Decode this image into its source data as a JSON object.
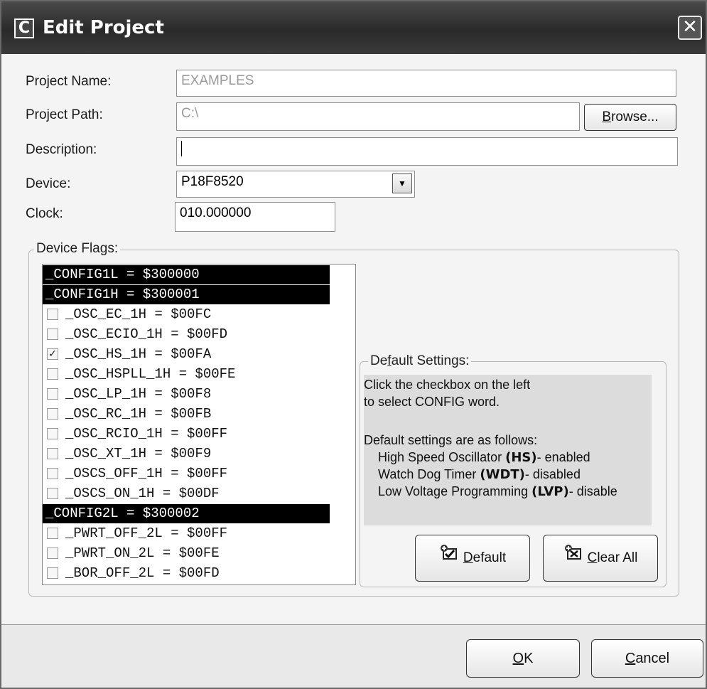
{
  "window": {
    "title": "Edit Project",
    "app_icon": "C",
    "close_icon": "close-icon"
  },
  "form": {
    "project_name_label": "Project Name:",
    "project_name_value": "EXAMPLES",
    "project_path_label": "Project Path:",
    "project_path_value": "C:\\",
    "browse_pre": "",
    "browse_key": "B",
    "browse_post": "rowse...",
    "description_label": "Description:",
    "description_value": "",
    "device_label": "Device:",
    "device_value": "P18F8520",
    "clock_label": "Clock:",
    "clock_value": "010.000000"
  },
  "device_flags": {
    "group_label": "Device Flags:",
    "rows": [
      {
        "type": "header",
        "text": "_CONFIG1L = $300000"
      },
      {
        "type": "header",
        "text": "_CONFIG1H = $300001"
      },
      {
        "type": "item",
        "checked": false,
        "text": "_OSC_EC_1H = $00FC"
      },
      {
        "type": "item",
        "checked": false,
        "text": "_OSC_ECIO_1H = $00FD"
      },
      {
        "type": "item",
        "checked": true,
        "text": "_OSC_HS_1H = $00FA"
      },
      {
        "type": "item",
        "checked": false,
        "text": "_OSC_HSPLL_1H = $00FE"
      },
      {
        "type": "item",
        "checked": false,
        "text": "_OSC_LP_1H = $00F8"
      },
      {
        "type": "item",
        "checked": false,
        "text": "_OSC_RC_1H = $00FB"
      },
      {
        "type": "item",
        "checked": false,
        "text": "_OSC_RCIO_1H = $00FF"
      },
      {
        "type": "item",
        "checked": false,
        "text": "_OSC_XT_1H = $00F9"
      },
      {
        "type": "item",
        "checked": false,
        "text": "_OSCS_OFF_1H = $00FF"
      },
      {
        "type": "item",
        "checked": false,
        "text": "_OSCS_ON_1H = $00DF"
      },
      {
        "type": "header",
        "text": "_CONFIG2L = $300002"
      },
      {
        "type": "item",
        "checked": false,
        "text": "_PWRT_OFF_2L = $00FF"
      },
      {
        "type": "item",
        "checked": false,
        "text": "_PWRT_ON_2L = $00FE"
      },
      {
        "type": "item",
        "checked": false,
        "text": "_BOR_OFF_2L = $00FD"
      }
    ]
  },
  "default_settings": {
    "group_pre": "De",
    "group_key": "f",
    "group_post": "ault Settings:",
    "line1": "Click the checkbox on the left",
    "line2": "to select CONFIG word.",
    "line3": "Default settings are as follows:",
    "l4a": "High Speed Oscillator ",
    "l4b": "(HS)",
    "l4c": "- enabled",
    "l5a": "Watch Dog Timer ",
    "l5b": "(WDT)",
    "l5c": "- disabled",
    "l6a": "Low Voltage Programming ",
    "l6b": "(LVP)",
    "l6c": "- disable",
    "default_key": "D",
    "default_rest": "efault",
    "clear_key": "C",
    "clear_rest": "lear All"
  },
  "footer": {
    "ok_key": "O",
    "ok_rest": "K",
    "cancel_key": "C",
    "cancel_rest": "ancel"
  }
}
